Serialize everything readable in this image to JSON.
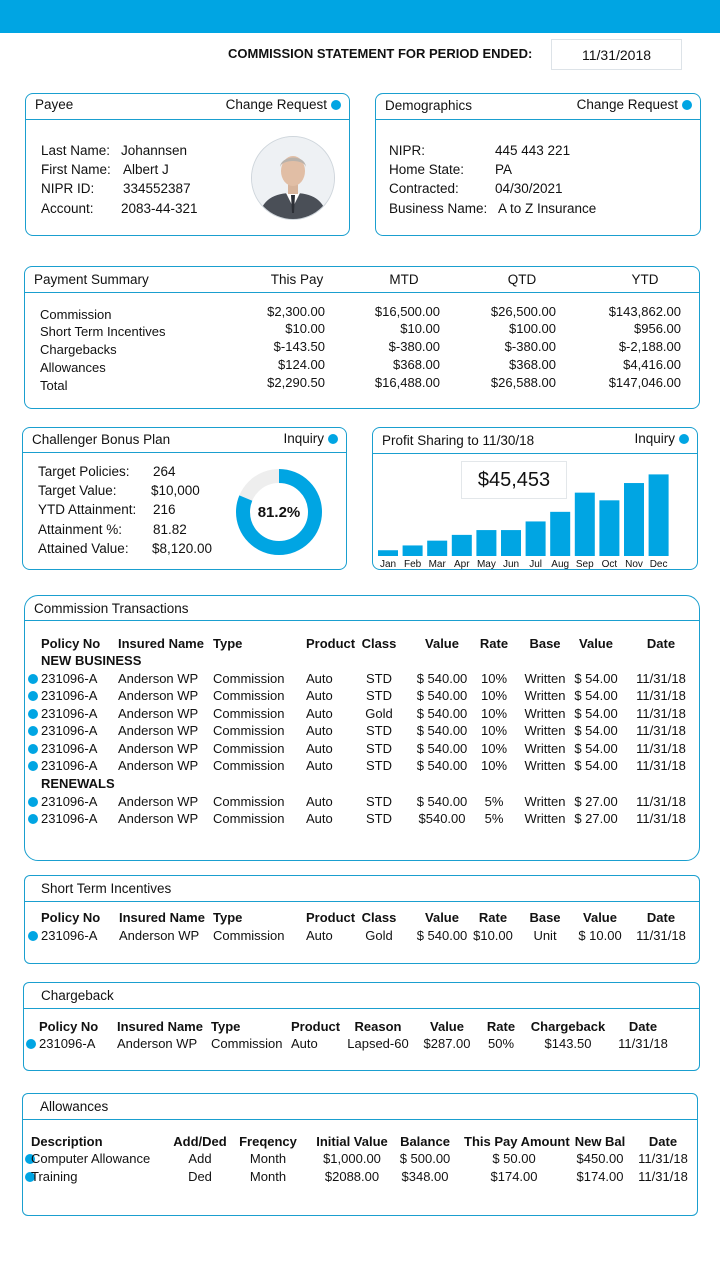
{
  "header": {
    "title": "COMMISSION STATEMENT FOR PERIOD ENDED:",
    "date": "11/31/2018"
  },
  "payee": {
    "title": "Payee",
    "action": "Change Request",
    "fields": [
      {
        "label": "Last Name:",
        "value": "Johannsen"
      },
      {
        "label": "First Name:",
        "value": "Albert J"
      },
      {
        "label": "NIPR ID:",
        "value": "334552387"
      },
      {
        "label": "Account:",
        "value": "2083-44-321"
      }
    ]
  },
  "demographics": {
    "title": "Demographics",
    "action": "Change Request",
    "fields": [
      {
        "label": "NIPR:",
        "value": "445 443 221"
      },
      {
        "label": "Home State:",
        "value": "PA"
      },
      {
        "label": "Contracted:",
        "value": "04/30/2021"
      },
      {
        "label": "Business Name:",
        "value": "A to Z Insurance"
      }
    ]
  },
  "payment_summary": {
    "title": "Payment Summary",
    "columns": [
      "This Pay",
      "MTD",
      "QTD",
      "YTD"
    ],
    "rows": [
      {
        "label": "Commission",
        "values": [
          "$2,300.00",
          "$16,500.00",
          "$26,500.00",
          "$143,862.00"
        ]
      },
      {
        "label": "Short Term Incentives",
        "values": [
          "$10.00",
          "$10.00",
          "$100.00",
          "$956.00"
        ]
      },
      {
        "label": "Chargebacks",
        "values": [
          "$-143.50",
          "$-380.00",
          "$-380.00",
          "$-2,188.00"
        ]
      },
      {
        "label": "Allowances",
        "values": [
          "$124.00",
          "$368.00",
          "$368.00",
          "$4,416.00"
        ]
      },
      {
        "label": "Total",
        "values": [
          "$2,290.50",
          "$16,488.00",
          "$26,588.00",
          "$147,046.00"
        ]
      }
    ]
  },
  "bonus_plan": {
    "title": "Challenger Bonus Plan",
    "action": "Inquiry",
    "fields": [
      {
        "label": "Target Policies:",
        "value": "264"
      },
      {
        "label": "Target Value:",
        "value": "$10,000"
      },
      {
        "label": "YTD Attainment:",
        "value": "216"
      },
      {
        "label": "Attainment %:",
        "value": "81.82"
      },
      {
        "label": "Attained Value:",
        "value": "$8,120.00"
      }
    ],
    "donut_label": "81.2%",
    "donut_fraction": 0.812,
    "colors": {
      "fill": "#00a5e3",
      "track": "#eeeeee"
    }
  },
  "profit_sharing": {
    "title": "Profit Sharing to 11/30/18",
    "action": "Inquiry",
    "total": "$45,453",
    "color": "#00a5e3"
  },
  "chart_data": {
    "type": "bar",
    "categories": [
      "Jan",
      "Feb",
      "Mar",
      "Apr",
      "May",
      "Jun",
      "Jul",
      "Aug",
      "Sep",
      "Oct",
      "Nov",
      "Dec"
    ],
    "values": [
      6,
      11,
      16,
      22,
      27,
      27,
      36,
      46,
      66,
      58,
      76,
      85
    ],
    "ylim": [
      0,
      100
    ],
    "grid": false
  },
  "commission_transactions": {
    "title": "Commission Transactions",
    "headers": [
      "Policy No",
      "Insured Name",
      "Type",
      "Product",
      "Class",
      "Value",
      "Rate",
      "Base",
      "Value",
      "Date"
    ],
    "groups": [
      {
        "label": "NEW BUSINESS",
        "rows": [
          [
            "231096-A",
            "Anderson WP",
            "Commission",
            "Auto",
            "STD",
            "$ 540.00",
            "10%",
            "Written",
            "$ 54.00",
            "11/31/18"
          ],
          [
            "231096-A",
            "Anderson WP",
            "Commission",
            "Auto",
            "STD",
            "$ 540.00",
            "10%",
            "Written",
            "$ 54.00",
            "11/31/18"
          ],
          [
            "231096-A",
            "Anderson WP",
            "Commission",
            "Auto",
            "Gold",
            "$ 540.00",
            "10%",
            "Written",
            "$ 54.00",
            "11/31/18"
          ],
          [
            "231096-A",
            "Anderson WP",
            "Commission",
            "Auto",
            "STD",
            "$ 540.00",
            "10%",
            "Written",
            "$ 54.00",
            "11/31/18"
          ],
          [
            "231096-A",
            "Anderson WP",
            "Commission",
            "Auto",
            "STD",
            "$ 540.00",
            "10%",
            "Written",
            "$ 54.00",
            "11/31/18"
          ],
          [
            "231096-A",
            "Anderson WP",
            "Commission",
            "Auto",
            "STD",
            "$ 540.00",
            "10%",
            "Written",
            "$ 54.00",
            "11/31/18"
          ]
        ]
      },
      {
        "label": "RENEWALS",
        "rows": [
          [
            "231096-A",
            "Anderson WP",
            "Commission",
            "Auto",
            "STD",
            "$ 540.00",
            "5%",
            "Written",
            "$ 27.00",
            "11/31/18"
          ],
          [
            "231096-A",
            "Anderson WP",
            "Commission",
            "Auto",
            "STD",
            "$540.00",
            "5%",
            "Written",
            "$ 27.00",
            "11/31/18"
          ]
        ]
      }
    ]
  },
  "short_term_incentives": {
    "title": "Short  Term Incentives",
    "headers": [
      "Policy No",
      "Insured Name",
      "Type",
      "Product",
      "Class",
      "Value",
      "Rate",
      "Base",
      "Value",
      "Date"
    ],
    "rows": [
      [
        "231096-A",
        "Anderson WP",
        "Commission",
        "Auto",
        "Gold",
        "$ 540.00",
        "$10.00",
        "Unit",
        "$ 10.00",
        "11/31/18"
      ]
    ]
  },
  "chargeback": {
    "title": "Chargeback",
    "headers": [
      "Policy No",
      "Insured Name",
      "Type",
      "Product",
      "Reason",
      "Value",
      "Rate",
      "Chargeback",
      "Date"
    ],
    "rows": [
      [
        "231096-A",
        "Anderson WP",
        "Commission",
        "Auto",
        "Lapsed-60",
        "$287.00",
        "50%",
        "$143.50",
        "11/31/18"
      ]
    ]
  },
  "allowances": {
    "title": "Allowances",
    "headers": [
      "Description",
      "Add/Ded",
      "Freqency",
      "Initial Value",
      "Balance",
      "This Pay Amount",
      "New Bal",
      "Date"
    ],
    "rows": [
      [
        "Computer Allowance",
        "Add",
        "Month",
        "$1,000.00",
        "$ 500.00",
        "$   50.00",
        "$450.00",
        "11/31/18"
      ],
      [
        "Training",
        "Ded",
        "Month",
        "$2088.00",
        "$348.00",
        "$174.00",
        "$174.00",
        "11/31/18"
      ]
    ]
  }
}
